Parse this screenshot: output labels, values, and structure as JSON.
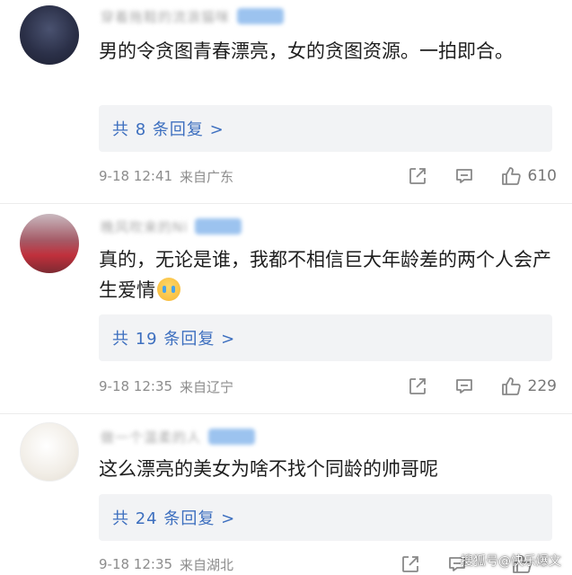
{
  "comments": [
    {
      "username": "穿着拖鞋的流浪猫咪",
      "text": "男的令贪图青春漂亮，女的贪图资源。一拍即合。",
      "reply_label": "共 8 条回复 >",
      "date": "9-18 12:41",
      "location": "来自广东",
      "likes": "610"
    },
    {
      "username": "晚风吹来的Ni",
      "text": "真的，无论是谁，我都不相信巨大年龄差的两个人会产生爱情",
      "reply_label": "共 19 条回复 >",
      "date": "9-18 12:35",
      "location": "来自辽宁",
      "likes": "229"
    },
    {
      "username": "做一个温柔的人",
      "text": "这么漂亮的美女为啥不找个同龄的帅哥呢",
      "reply_label": "共 24 条回复 >",
      "date": "9-18 12:35",
      "location": "来自湖北",
      "likes": ""
    }
  ],
  "watermark": "搜狐号@快乐爆文",
  "icons": [
    "share-icon",
    "comment-icon",
    "like-icon",
    "cry-emoji"
  ],
  "colors": {
    "reply_link": "#3d6fbf",
    "reply_bg": "#f2f3f5",
    "meta_text": "#8c8c8c",
    "badge": "#9cc3ef"
  }
}
